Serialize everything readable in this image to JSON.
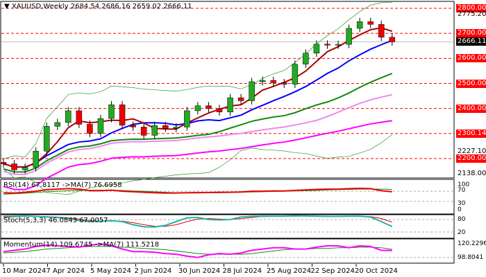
{
  "header": {
    "symbol": "XAUUSD,Weekly",
    "ohlc": "2684.54 2686.16 2659.02 2666.11"
  },
  "price_labels": {
    "red": [
      "2800.00",
      "2700.00",
      "2600.00",
      "2500.00",
      "2400.00",
      "2300.14",
      "2200.00"
    ],
    "current": "2666.11",
    "plain": [
      "2775.20",
      "2227.10",
      "2138.00"
    ]
  },
  "panels": {
    "rsi": {
      "label": "RSI(14) 67.8117 ->MA(7) 76.6958",
      "scale": [
        "100",
        "70",
        "30",
        "0"
      ]
    },
    "stoch": {
      "label": "Stoch(5,3,3) 46.0843 67.0057",
      "scale": [
        "80",
        "20"
      ]
    },
    "momentum": {
      "label": "Momentum(14) 109.6745 ->MA(7) 111.5218",
      "scale": [
        "120.2296",
        "98.8041"
      ]
    }
  },
  "dates": [
    "10 Mar 2024",
    "7 Apr 2024",
    "5 May 2024",
    "2 Jun 2024",
    "30 Jun 2024",
    "28 Jul 2024",
    "25 Aug 2024",
    "22 Sep 2024",
    "20 Oct 2024"
  ],
  "chart_data": {
    "type": "candlestick",
    "levels": [
      2800,
      2700,
      2600,
      2500,
      2400,
      2300.14,
      2200
    ],
    "ylim": [
      2138,
      2815
    ],
    "closes": [
      2179,
      2155,
      2165,
      2230,
      2329,
      2344,
      2391,
      2337,
      2301,
      2360,
      2415,
      2333,
      2326,
      2293,
      2332,
      2321,
      2326,
      2391,
      2411,
      2400,
      2386,
      2443,
      2431,
      2507,
      2512,
      2503,
      2497,
      2577,
      2621,
      2657,
      2653,
      2656,
      2720,
      2747,
      2736,
      2684.54,
      2666.11
    ],
    "first_open": 2185,
    "rsi": [
      64,
      63,
      66,
      70,
      76,
      78,
      80,
      78,
      72,
      72,
      74,
      70,
      68,
      66,
      64,
      63,
      63,
      64,
      65,
      65,
      66,
      66,
      67,
      70,
      70,
      71,
      71,
      73,
      75,
      77,
      78,
      78,
      80,
      81,
      80,
      72,
      68
    ],
    "rsi_ma": [
      58,
      60,
      62,
      65,
      68,
      70,
      72,
      73,
      74,
      74,
      74,
      73,
      71,
      70,
      68,
      66,
      64,
      63,
      63,
      64,
      64,
      65,
      66,
      67,
      68,
      69,
      70,
      71,
      72,
      73,
      75,
      76,
      77,
      78,
      78,
      78,
      77
    ],
    "stoch_k": [
      95,
      96,
      97,
      95,
      92,
      90,
      85,
      75,
      70,
      72,
      74,
      70,
      55,
      45,
      44,
      52,
      70,
      88,
      90,
      80,
      78,
      80,
      92,
      95,
      96,
      96,
      96,
      98,
      97,
      96,
      95,
      95,
      96,
      96,
      92,
      70,
      46
    ],
    "stoch_d": [
      90,
      93,
      95,
      95,
      94,
      92,
      88,
      82,
      75,
      72,
      72,
      72,
      65,
      55,
      48,
      47,
      55,
      70,
      82,
      85,
      82,
      80,
      84,
      90,
      94,
      95,
      96,
      96,
      97,
      97,
      96,
      95,
      95,
      95,
      94,
      85,
      67
    ],
    "momentum": [
      108,
      110,
      112,
      116,
      118,
      117,
      116,
      115,
      118,
      120,
      117,
      112,
      108,
      108,
      107,
      105,
      104,
      101,
      99,
      103,
      105,
      104,
      106,
      110,
      112,
      114,
      114,
      112,
      112,
      115,
      117,
      117,
      114,
      117,
      116,
      110,
      109.7
    ],
    "momentum_ma": [
      106,
      107,
      108,
      110,
      112,
      113,
      114,
      115,
      116,
      116,
      116,
      115,
      114,
      113,
      112,
      111,
      109,
      107,
      105,
      104,
      104,
      104,
      104,
      105,
      107,
      109,
      111,
      112,
      112,
      113,
      113,
      114,
      114,
      115,
      115,
      114,
      111.5
    ]
  },
  "colors": {
    "up": "#22aa22",
    "down": "#ee0000",
    "level": "#ff0000"
  }
}
